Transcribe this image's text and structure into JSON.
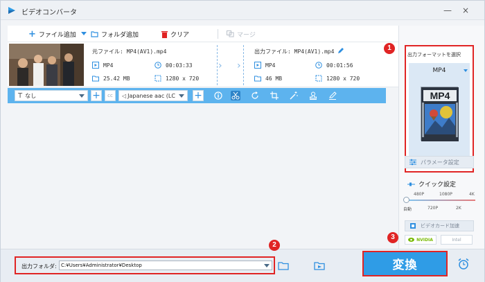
{
  "window": {
    "title": "ビデオコンバータ",
    "minimize": "—",
    "close": "×"
  },
  "toolbar": {
    "add_file": "ファイル追加",
    "add_folder": "フォルダ追加",
    "clear": "クリア",
    "merge": "マージ"
  },
  "file": {
    "source_title": "元ファイル: MP4(AV1).mp4",
    "source_format": "MP4",
    "source_duration": "00:03:33",
    "source_size": "25.42 MB",
    "source_resolution": "1280 x 720",
    "output_title": "出力ファイル: MP4(AV1).mp4",
    "output_format": "MP4",
    "output_duration": "00:01:56",
    "output_size": "46 MB",
    "output_resolution": "1280 x 720"
  },
  "editbar": {
    "subtitle_value": "なし",
    "audio_value": "Japanese aac (LC"
  },
  "right_panel": {
    "format_label": "出力フォーマットを選択",
    "format_name": "MP4",
    "format_card_text": "MP4",
    "param_button": "パラメータ設定",
    "quick_label": "クイック設定",
    "quick_top_ticks": [
      "480P",
      "1080P",
      "4K"
    ],
    "quick_bottom_ticks": [
      "自動",
      "720P",
      "2K"
    ],
    "gpu_label": "ビデオカード加速",
    "nvidia": "NVIDIA",
    "intel": "Intel"
  },
  "bottom": {
    "output_folder_label": "出力フォルダ:",
    "output_folder_path": "C:¥Users¥Administrator¥Desktop",
    "convert_button": "変換"
  },
  "steps": [
    "1",
    "2",
    "3"
  ],
  "colors": {
    "accent": "#2f9ce6",
    "editbar": "#5db3ee",
    "highlight": "#e02424"
  }
}
